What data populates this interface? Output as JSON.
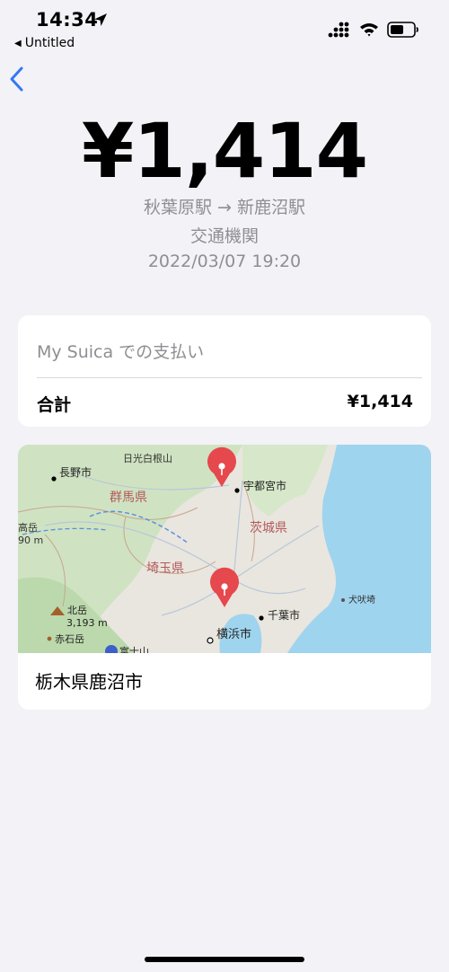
{
  "status_bar": {
    "time": "14:34",
    "back_app": "Untitled"
  },
  "transaction": {
    "amount": "¥1,414",
    "route": "秋葉原駅 → 新鹿沼駅",
    "category": "交通機関",
    "datetime": "2022/03/07 19:20"
  },
  "payment": {
    "method": "My Suica での支払い",
    "total_label": "合計",
    "total_value": "¥1,414"
  },
  "map": {
    "labels": {
      "nikko": "日光白根山",
      "nagano": "長野市",
      "gunma": "群馬県",
      "utsunomiya": "宇都宮市",
      "ibaraki": "茨城県",
      "saitama": "埼玉県",
      "chiba": "千葉市",
      "yokohama": "横浜市",
      "kitadake": "北岳",
      "kitadake_elev": "3,193 m",
      "akaishi": "赤石岳",
      "fuji": "富士山",
      "inubo": "犬吠埼",
      "edge_peak": "高岳",
      "edge_elev": "90 m"
    },
    "place": "栃木県鹿沼市"
  },
  "colors": {
    "background": "#f2f2f7",
    "accent": "#3478f6",
    "secondary_text": "#8e8e93",
    "pin": "#e5484d",
    "sea": "#9fd4ee"
  }
}
